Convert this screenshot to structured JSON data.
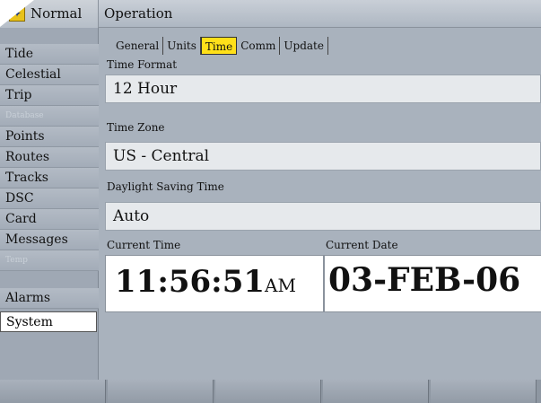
{
  "titlebar": {
    "mode": "Normal",
    "operation": "Operation"
  },
  "sidebar": {
    "items": [
      {
        "label": "Tide"
      },
      {
        "label": "Celestial"
      },
      {
        "label": "Trip"
      },
      {
        "label": "Database"
      },
      {
        "label": "Points"
      },
      {
        "label": "Routes"
      },
      {
        "label": "Tracks"
      },
      {
        "label": "DSC"
      },
      {
        "label": "Card"
      },
      {
        "label": "Messages"
      },
      {
        "label": "Temp"
      },
      {
        "label": "Alarms"
      },
      {
        "label": "System"
      }
    ]
  },
  "tabs": [
    "General",
    "Units",
    "Time",
    "Comm",
    "Update"
  ],
  "time_format": {
    "label": "Time Format",
    "value": "12 Hour"
  },
  "time_zone": {
    "label": "Time Zone",
    "value": "US - Central"
  },
  "dst": {
    "label": "Daylight Saving Time",
    "value": "Auto"
  },
  "current_time": {
    "label": "Current Time",
    "value": "11:56:51",
    "ampm": "AM"
  },
  "current_date": {
    "label": "Current Date",
    "value": "03-FEB-06"
  },
  "colors": {
    "active_tab": "#ffe01a",
    "panel": "#a9b2bd",
    "field": "#e6e9ec"
  }
}
